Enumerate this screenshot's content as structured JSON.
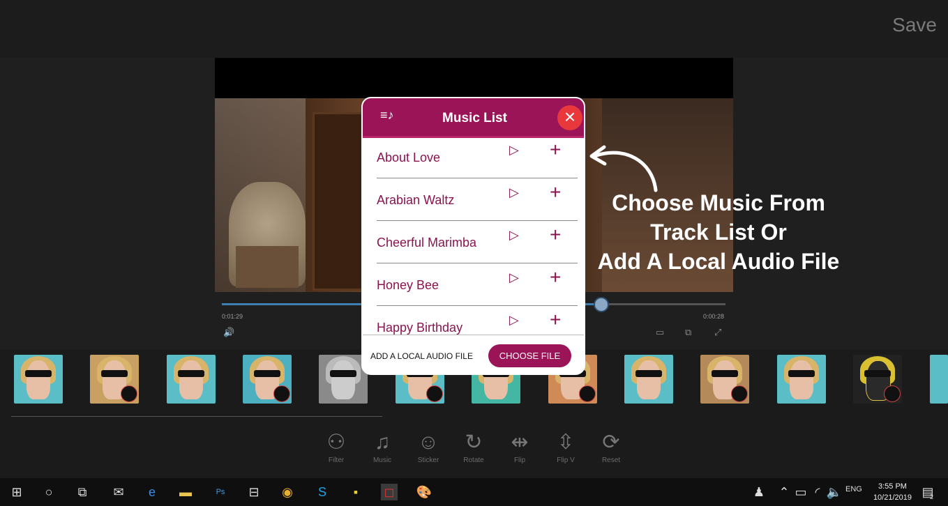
{
  "header": {
    "save_label": "Save"
  },
  "player": {
    "time_current": "0:01:29",
    "time_total": "0:00:28",
    "progress_fraction": 0.74
  },
  "music_dialog": {
    "title": "Music List",
    "close_glyph": "×",
    "tracks": [
      {
        "name": "About Love"
      },
      {
        "name": "Arabian Waltz"
      },
      {
        "name": "Cheerful Marimba"
      },
      {
        "name": "Honey Bee"
      },
      {
        "name": "Happy Birthday"
      }
    ],
    "play_glyph": "▷",
    "add_glyph": "+",
    "footer_label": "ADD A LOCAL AUDIO FILE",
    "choose_file_label": "CHOOSE FILE",
    "accent_color": "#9b1457",
    "close_color": "#e8383b"
  },
  "annotation": {
    "line1": "Choose Music From",
    "line2": "Track List Or",
    "line3": "Add A Local Audio File"
  },
  "tools": [
    {
      "label": "Filter",
      "glyph": "⚇",
      "icon": "filter-icon"
    },
    {
      "label": "Music",
      "glyph": "♫",
      "icon": "music-icon"
    },
    {
      "label": "Sticker",
      "glyph": "☺",
      "icon": "sticker-icon"
    },
    {
      "label": "Rotate",
      "glyph": "↻",
      "icon": "rotate-icon"
    },
    {
      "label": "Flip",
      "glyph": "⇹",
      "icon": "flip-icon"
    },
    {
      "label": "Flip V",
      "glyph": "⇳",
      "icon": "flip-vertical-icon"
    },
    {
      "label": "Reset",
      "glyph": "⟳",
      "icon": "reset-icon"
    }
  ],
  "taskbar": {
    "language": "ENG",
    "time": "3:55 PM",
    "date": "10/21/2019",
    "notification_count": "2"
  }
}
